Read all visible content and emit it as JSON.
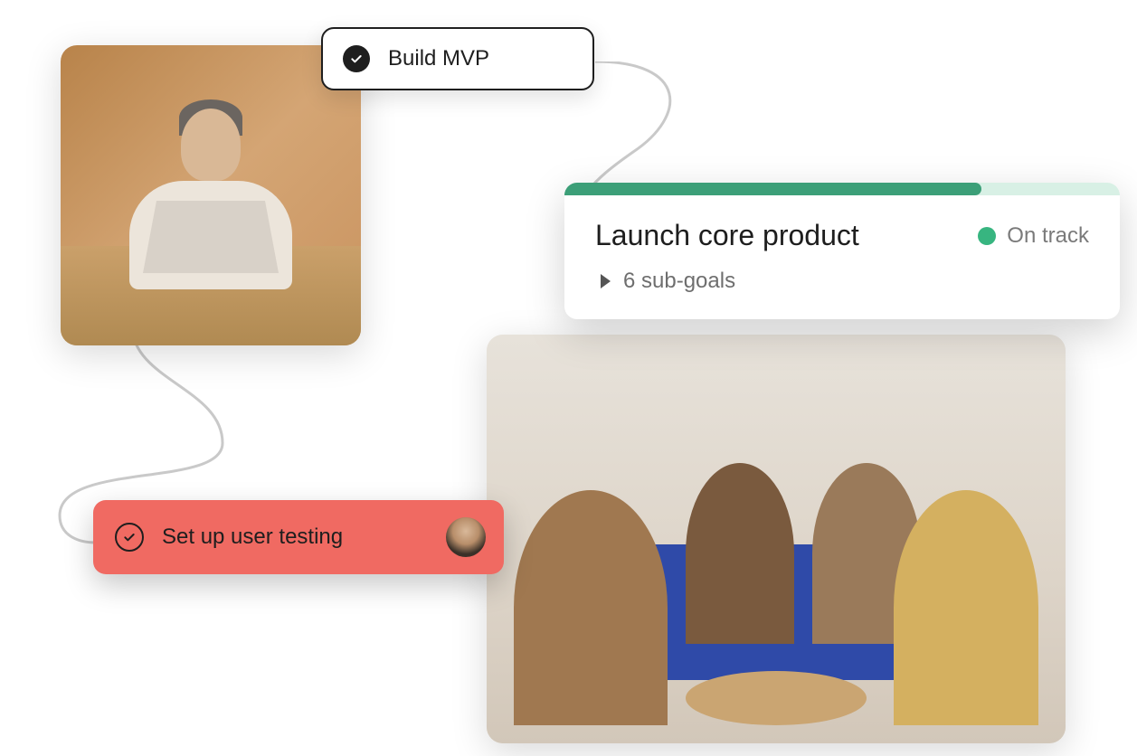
{
  "cards": {
    "build_mvp": {
      "label": "Build MVP",
      "completed": true
    },
    "launch": {
      "title": "Launch core product",
      "status_label": "On track",
      "status_color": "#37b580",
      "progress_pct": 75,
      "sub_goals_label": "6 sub-goals"
    },
    "user_testing": {
      "label": "Set up user testing",
      "bg_color": "#f06a62",
      "assignee_icon": "avatar"
    }
  }
}
